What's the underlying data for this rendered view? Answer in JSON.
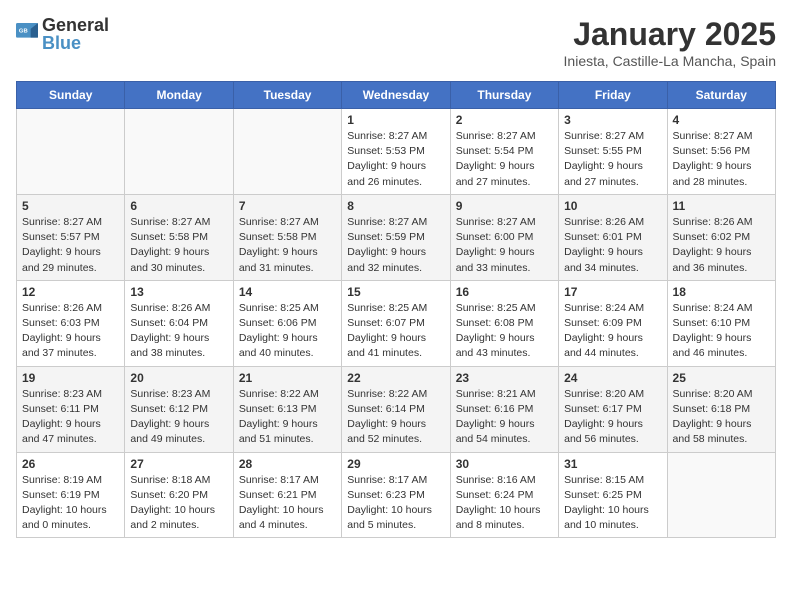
{
  "header": {
    "logo_general": "General",
    "logo_blue": "Blue",
    "title": "January 2025",
    "subtitle": "Iniesta, Castille-La Mancha, Spain"
  },
  "weekdays": [
    "Sunday",
    "Monday",
    "Tuesday",
    "Wednesday",
    "Thursday",
    "Friday",
    "Saturday"
  ],
  "weeks": [
    [
      {
        "day": "",
        "info": ""
      },
      {
        "day": "",
        "info": ""
      },
      {
        "day": "",
        "info": ""
      },
      {
        "day": "1",
        "info": "Sunrise: 8:27 AM\nSunset: 5:53 PM\nDaylight: 9 hours and 26 minutes."
      },
      {
        "day": "2",
        "info": "Sunrise: 8:27 AM\nSunset: 5:54 PM\nDaylight: 9 hours and 27 minutes."
      },
      {
        "day": "3",
        "info": "Sunrise: 8:27 AM\nSunset: 5:55 PM\nDaylight: 9 hours and 27 minutes."
      },
      {
        "day": "4",
        "info": "Sunrise: 8:27 AM\nSunset: 5:56 PM\nDaylight: 9 hours and 28 minutes."
      }
    ],
    [
      {
        "day": "5",
        "info": "Sunrise: 8:27 AM\nSunset: 5:57 PM\nDaylight: 9 hours and 29 minutes."
      },
      {
        "day": "6",
        "info": "Sunrise: 8:27 AM\nSunset: 5:58 PM\nDaylight: 9 hours and 30 minutes."
      },
      {
        "day": "7",
        "info": "Sunrise: 8:27 AM\nSunset: 5:58 PM\nDaylight: 9 hours and 31 minutes."
      },
      {
        "day": "8",
        "info": "Sunrise: 8:27 AM\nSunset: 5:59 PM\nDaylight: 9 hours and 32 minutes."
      },
      {
        "day": "9",
        "info": "Sunrise: 8:27 AM\nSunset: 6:00 PM\nDaylight: 9 hours and 33 minutes."
      },
      {
        "day": "10",
        "info": "Sunrise: 8:26 AM\nSunset: 6:01 PM\nDaylight: 9 hours and 34 minutes."
      },
      {
        "day": "11",
        "info": "Sunrise: 8:26 AM\nSunset: 6:02 PM\nDaylight: 9 hours and 36 minutes."
      }
    ],
    [
      {
        "day": "12",
        "info": "Sunrise: 8:26 AM\nSunset: 6:03 PM\nDaylight: 9 hours and 37 minutes."
      },
      {
        "day": "13",
        "info": "Sunrise: 8:26 AM\nSunset: 6:04 PM\nDaylight: 9 hours and 38 minutes."
      },
      {
        "day": "14",
        "info": "Sunrise: 8:25 AM\nSunset: 6:06 PM\nDaylight: 9 hours and 40 minutes."
      },
      {
        "day": "15",
        "info": "Sunrise: 8:25 AM\nSunset: 6:07 PM\nDaylight: 9 hours and 41 minutes."
      },
      {
        "day": "16",
        "info": "Sunrise: 8:25 AM\nSunset: 6:08 PM\nDaylight: 9 hours and 43 minutes."
      },
      {
        "day": "17",
        "info": "Sunrise: 8:24 AM\nSunset: 6:09 PM\nDaylight: 9 hours and 44 minutes."
      },
      {
        "day": "18",
        "info": "Sunrise: 8:24 AM\nSunset: 6:10 PM\nDaylight: 9 hours and 46 minutes."
      }
    ],
    [
      {
        "day": "19",
        "info": "Sunrise: 8:23 AM\nSunset: 6:11 PM\nDaylight: 9 hours and 47 minutes."
      },
      {
        "day": "20",
        "info": "Sunrise: 8:23 AM\nSunset: 6:12 PM\nDaylight: 9 hours and 49 minutes."
      },
      {
        "day": "21",
        "info": "Sunrise: 8:22 AM\nSunset: 6:13 PM\nDaylight: 9 hours and 51 minutes."
      },
      {
        "day": "22",
        "info": "Sunrise: 8:22 AM\nSunset: 6:14 PM\nDaylight: 9 hours and 52 minutes."
      },
      {
        "day": "23",
        "info": "Sunrise: 8:21 AM\nSunset: 6:16 PM\nDaylight: 9 hours and 54 minutes."
      },
      {
        "day": "24",
        "info": "Sunrise: 8:20 AM\nSunset: 6:17 PM\nDaylight: 9 hours and 56 minutes."
      },
      {
        "day": "25",
        "info": "Sunrise: 8:20 AM\nSunset: 6:18 PM\nDaylight: 9 hours and 58 minutes."
      }
    ],
    [
      {
        "day": "26",
        "info": "Sunrise: 8:19 AM\nSunset: 6:19 PM\nDaylight: 10 hours and 0 minutes."
      },
      {
        "day": "27",
        "info": "Sunrise: 8:18 AM\nSunset: 6:20 PM\nDaylight: 10 hours and 2 minutes."
      },
      {
        "day": "28",
        "info": "Sunrise: 8:17 AM\nSunset: 6:21 PM\nDaylight: 10 hours and 4 minutes."
      },
      {
        "day": "29",
        "info": "Sunrise: 8:17 AM\nSunset: 6:23 PM\nDaylight: 10 hours and 5 minutes."
      },
      {
        "day": "30",
        "info": "Sunrise: 8:16 AM\nSunset: 6:24 PM\nDaylight: 10 hours and 8 minutes."
      },
      {
        "day": "31",
        "info": "Sunrise: 8:15 AM\nSunset: 6:25 PM\nDaylight: 10 hours and 10 minutes."
      },
      {
        "day": "",
        "info": ""
      }
    ]
  ]
}
